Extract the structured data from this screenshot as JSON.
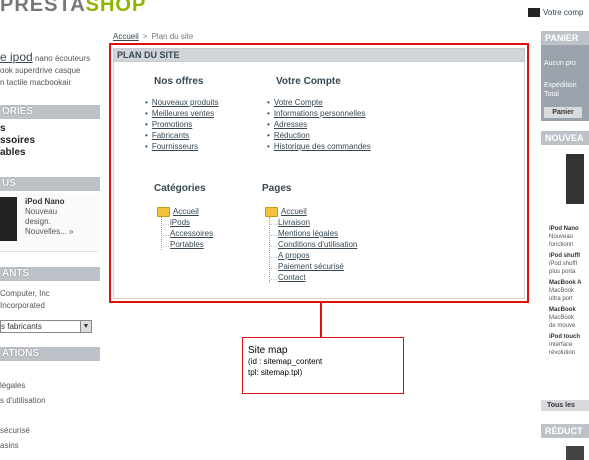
{
  "header": {
    "logo_part1": "PRESTA",
    "logo_part2": "SHOP",
    "top_link": "Votre comp"
  },
  "left": {
    "tags": {
      "line1_big": "e ipod",
      "line1_rest": "nano écouteurs",
      "line2": "ook superdrive casque",
      "line3": "n tactile macbookair"
    },
    "categories_title": "ORIES",
    "categories": [
      "s",
      "ssoires",
      "ables"
    ],
    "news_title": "US",
    "news_item": {
      "title": "iPod Nano",
      "l1": "Nouveau",
      "l2": "design.",
      "l3": "Nouvelles... »"
    },
    "manufacturers_title": "ANTS",
    "manufacturers": [
      "Computer, Inc",
      "Incorporated"
    ],
    "manufacturers_select": "s fabricants",
    "info_title": "ATIONS",
    "info_links": [
      "légales",
      "s d'utilisation",
      "",
      "sécurisé",
      "asins"
    ]
  },
  "breadcrumb": {
    "home": "Accueil",
    "separator": ">",
    "current": "Plan du site"
  },
  "sitemap": {
    "title": "PLAN DU SITE",
    "offers_title": "Nos offres",
    "offers": [
      "Nouveaux produits",
      "Meilleures ventes",
      "Promotions",
      "Fabricants",
      "Fournisseurs"
    ],
    "account_title": "Votre Compte",
    "account": [
      "Votre Compte",
      "Informations personnelles",
      "Adresses",
      "Réduction",
      "Historique des commandes"
    ],
    "categories_title": "Catégories",
    "categories_root": "Accueil",
    "categories": [
      "iPods",
      "Accessoires",
      "Portables"
    ],
    "pages_title": "Pages",
    "pages_root": "Accueil",
    "pages": [
      "Livraison",
      "Mentions légales",
      "Conditions d'utilisation",
      "A propos",
      "Paiement sécurisé",
      "Contact"
    ]
  },
  "callout": {
    "line1": "Site map",
    "line2": "(id : sitemap_content",
    "line3": "tpl: sitemap.tpl)"
  },
  "right": {
    "cart_title": "PANIER",
    "cart_l1": "Aucun pro",
    "cart_l2": "Expédition",
    "cart_l3": "Total",
    "cart_button": "Panier",
    "new_title": "NOUVEA",
    "new_items": [
      {
        "name": "iPod Nano",
        "desc": [
          "Nouveau",
          "fonctionn"
        ]
      },
      {
        "name": "iPod shuffl",
        "desc": [
          "iPod shuffl",
          "plus porta"
        ]
      },
      {
        "name": "MacBook A",
        "desc": [
          "MacBook",
          "ultra port"
        ]
      },
      {
        "name": "MacBook",
        "desc": [
          "MacBook",
          "de mouve"
        ]
      },
      {
        "name": "iPod touch",
        "desc": [
          "Interface",
          "révolution"
        ]
      }
    ],
    "all_button": "Tous les",
    "reduc_title": "RÉDUCT"
  },
  "colors": {
    "accent_red": "#e01010",
    "header_grey": "#bdc2c9",
    "link": "#374853",
    "logo_green": "#8fb400"
  }
}
